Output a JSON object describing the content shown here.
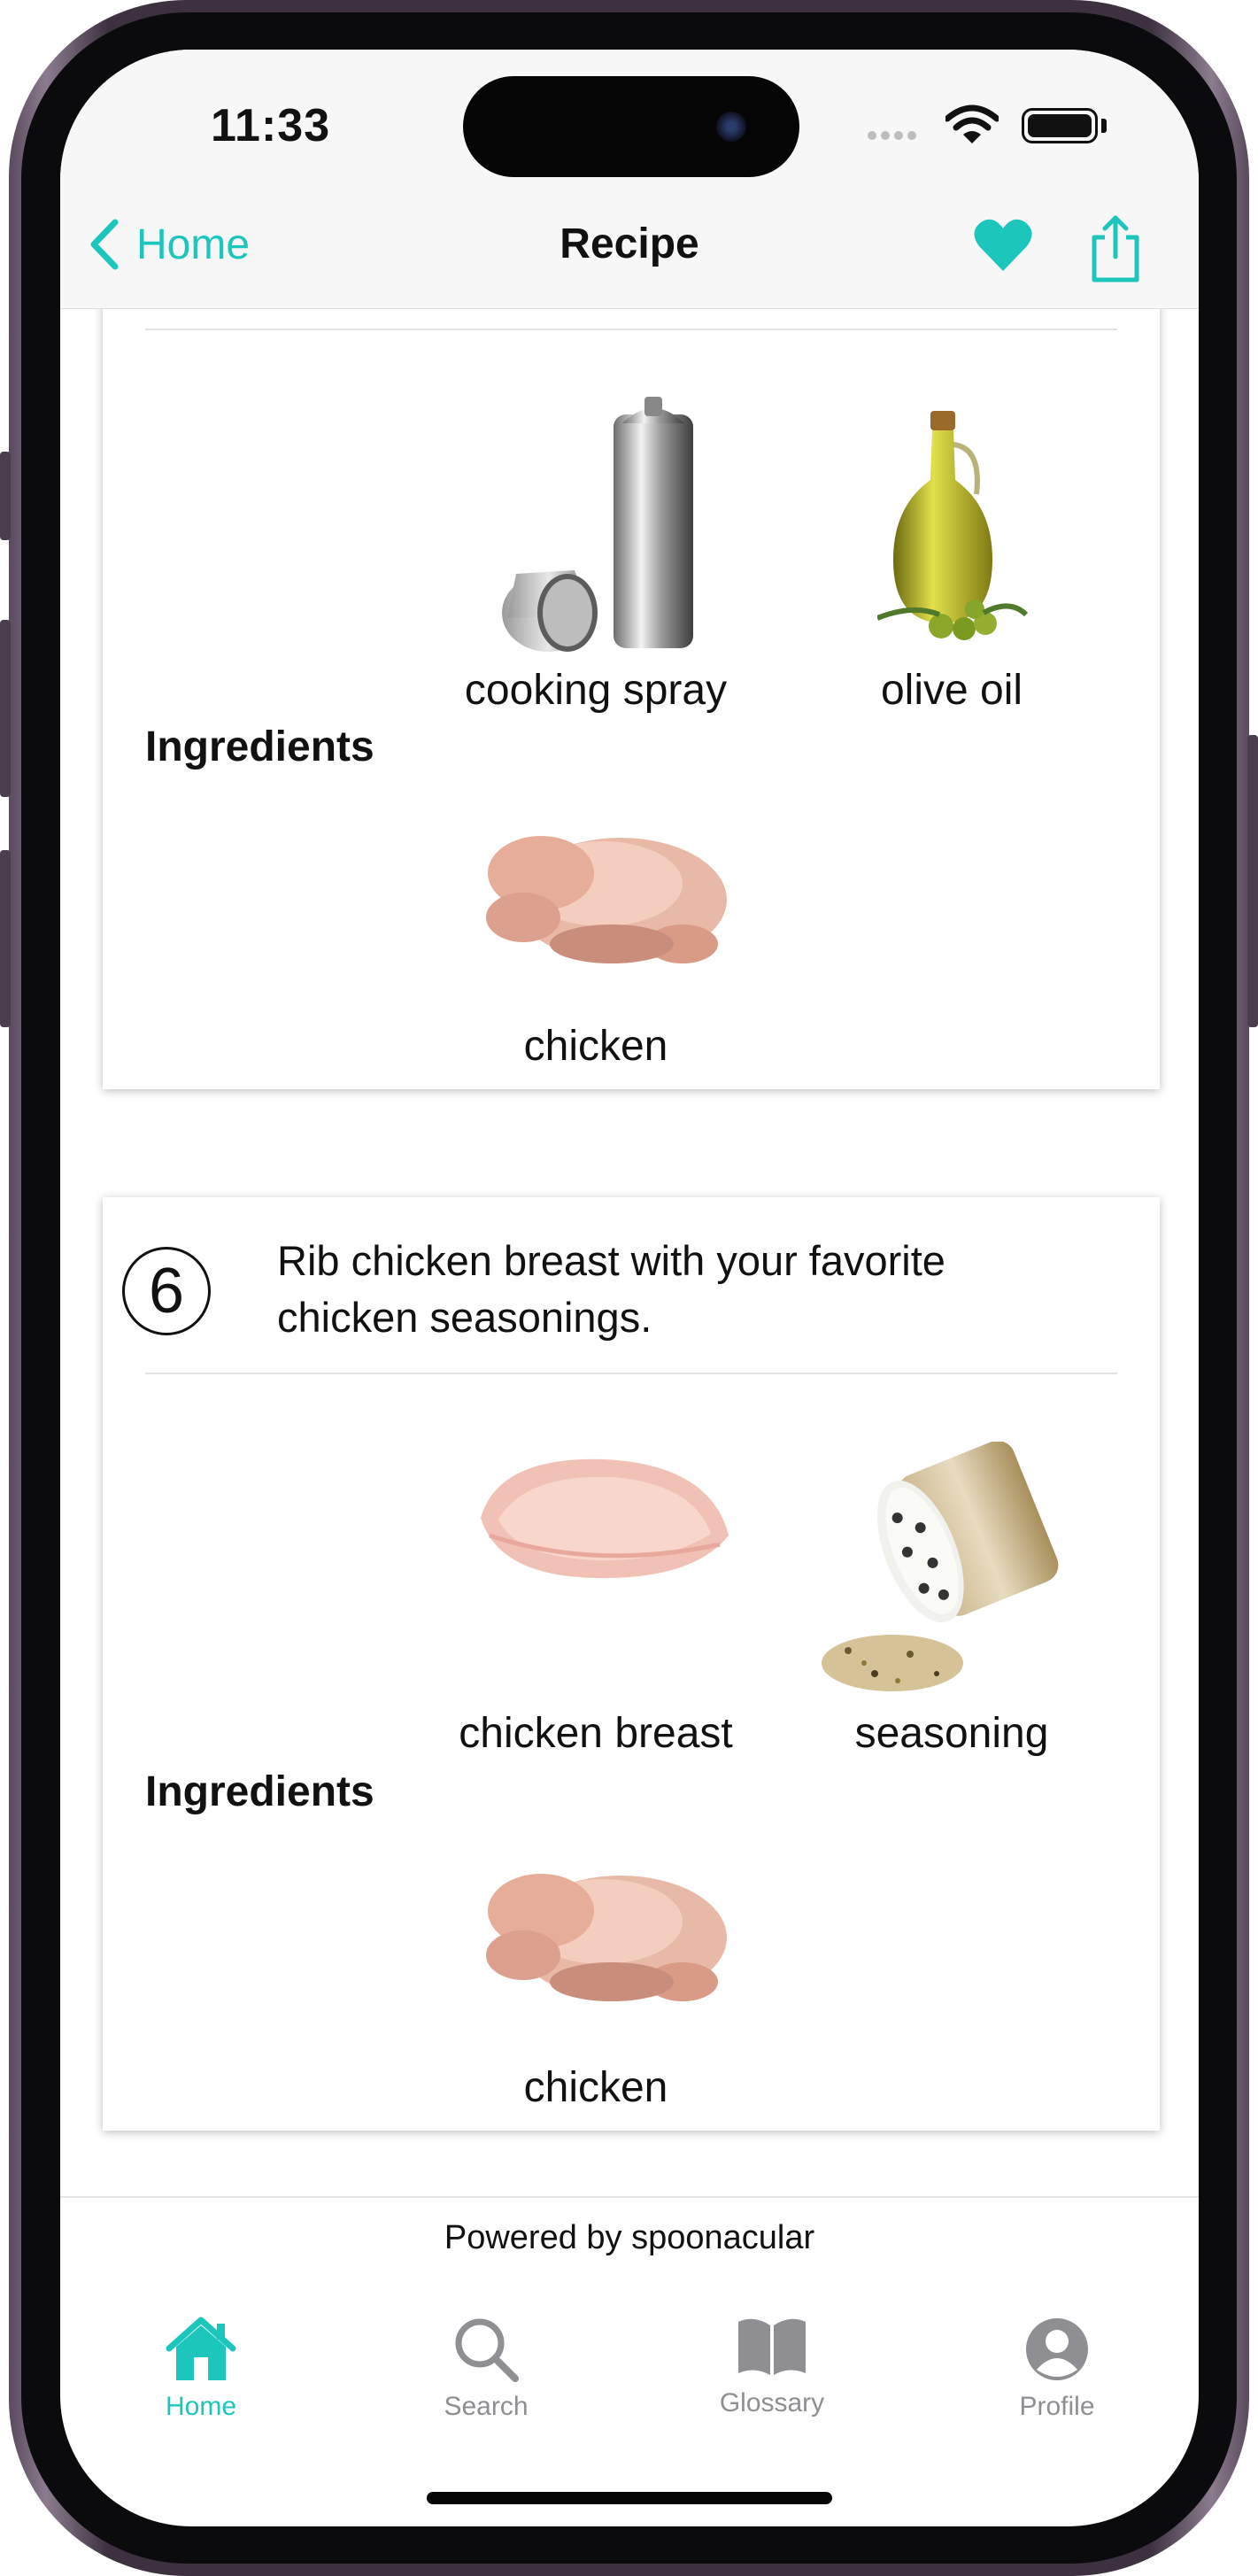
{
  "status_bar": {
    "time": "11:33"
  },
  "nav": {
    "back_label": "Home",
    "title": "Recipe",
    "accent_color": "#1cc6bd"
  },
  "step5": {
    "ingredients_label": "Ingredients",
    "ingredients": [
      {
        "name": "cooking spray",
        "icon": "cooking-spray-can"
      },
      {
        "name": "olive oil",
        "icon": "olive-oil-bottle"
      },
      {
        "name": "chicken",
        "icon": "whole-chicken"
      }
    ]
  },
  "step6": {
    "number": "6",
    "instruction_line1": "Rib chicken breast with your favorite",
    "instruction_line2": "chicken seasonings.",
    "ingredients_label": "Ingredients",
    "ingredients": [
      {
        "name": "chicken breast",
        "icon": "chicken-breast"
      },
      {
        "name": "seasoning",
        "icon": "seasoning-shaker"
      },
      {
        "name": "chicken",
        "icon": "whole-chicken"
      }
    ]
  },
  "footer": {
    "powered_by": "Powered by spoonacular"
  },
  "tabs": [
    {
      "label": "Home",
      "icon": "house-icon",
      "active": true
    },
    {
      "label": "Search",
      "icon": "search-icon",
      "active": false
    },
    {
      "label": "Glossary",
      "icon": "book-icon",
      "active": false
    },
    {
      "label": "Profile",
      "icon": "person-icon",
      "active": false
    }
  ],
  "colors": {
    "active_tab": "#1cc6bd",
    "inactive_tab": "#8e8e93"
  }
}
